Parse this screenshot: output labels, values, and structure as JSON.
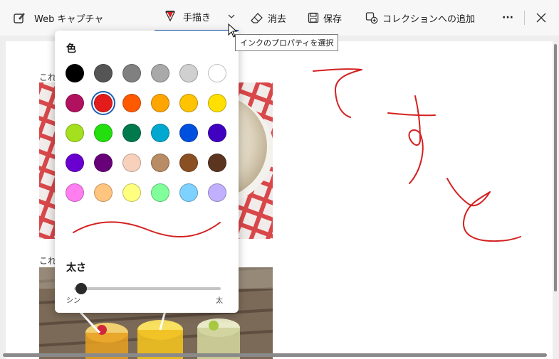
{
  "toolbar": {
    "title": "Web キャプチャ",
    "draw_label": "手描き",
    "erase_label": "消去",
    "save_label": "保存",
    "collection_label": "コレクションへの追加",
    "more_label": "···"
  },
  "tooltip": "インクのプロパティを選択",
  "panel": {
    "color_heading": "色",
    "thickness_heading": "太さ",
    "thin_label": "シン",
    "thick_label": "太",
    "thickness_level": 0.05,
    "colors": [
      "#000000",
      "#555555",
      "#808080",
      "#a9a9a9",
      "#d0d0d0",
      "#ffffff",
      "#b0125f",
      "#e31b1b",
      "#ff5a00",
      "#ffa500",
      "#ffc300",
      "#ffe000",
      "#a4e01e",
      "#23df0e",
      "#007a4d",
      "#00a8cf",
      "#0050e0",
      "#4000c0",
      "#6a00d0",
      "#68007a",
      "#f8d1bd",
      "#b88c64",
      "#8b4f24",
      "#5c3520",
      "#ff7ef0",
      "#ffc47e",
      "#ffff80",
      "#80ff9a",
      "#7ed2ff",
      "#c0b0ff"
    ],
    "selected_color_index": 7
  },
  "page": {
    "caption1": "これ",
    "caption2": "これ"
  },
  "ink_color": "#d42020"
}
